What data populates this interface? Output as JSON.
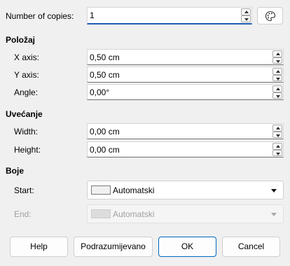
{
  "copies": {
    "label": "Number of copies:",
    "value": "1"
  },
  "position": {
    "heading": "Položaj",
    "x_label": "X axis:",
    "x_value": "0,50 cm",
    "y_label": "Y axis:",
    "y_value": "0,50 cm",
    "angle_label": "Angle:",
    "angle_value": "0,00°"
  },
  "enlargement": {
    "heading": "Uvećanje",
    "width_label": "Width:",
    "width_value": "0,00 cm",
    "height_label": "Height:",
    "height_value": "0,00 cm"
  },
  "colors": {
    "heading": "Boje",
    "start_label": "Start:",
    "start_value": "Automatski",
    "end_label": "End:",
    "end_value": "Automatski"
  },
  "buttons": {
    "help": "Help",
    "reset": "Podrazumijevano",
    "ok": "OK",
    "cancel": "Cancel"
  },
  "icons": {
    "values_from_selection": "palette-icon"
  },
  "colors_theme": {
    "default_button_border": "#0067c0",
    "background": "#f0f0f0"
  }
}
